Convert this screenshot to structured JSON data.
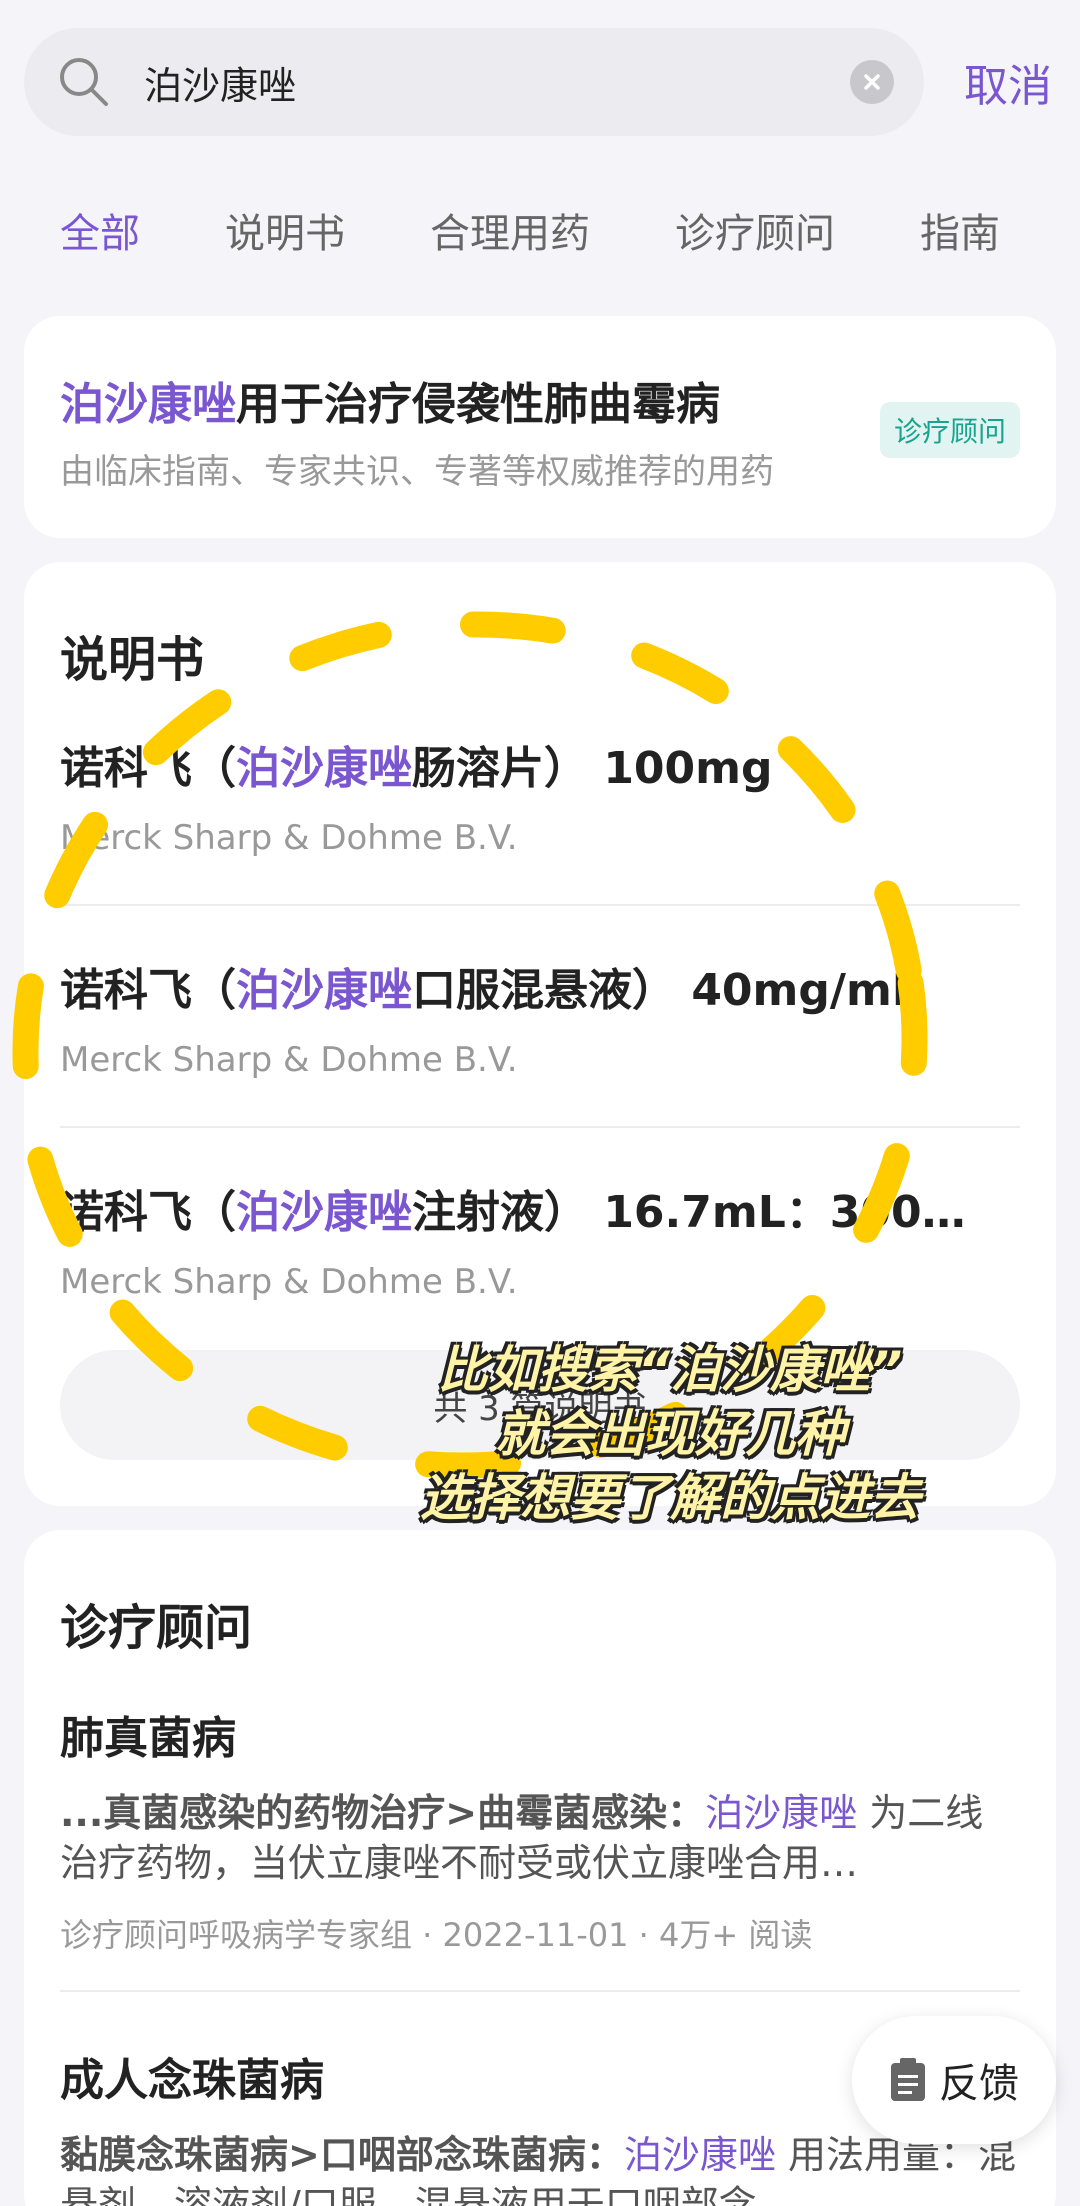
{
  "search": {
    "query": "泊沙康唑",
    "cancel_label": "取消"
  },
  "tabs": [
    {
      "label": "全部",
      "active": true
    },
    {
      "label": "说明书",
      "active": false
    },
    {
      "label": "合理用药",
      "active": false
    },
    {
      "label": "诊疗顾问",
      "active": false
    },
    {
      "label": "指南",
      "active": false
    }
  ],
  "highlight_term": "泊沙康唑",
  "top_card": {
    "title_highlight": "泊沙康唑",
    "title_rest": "用于治疗侵袭性肺曲霉病",
    "subtitle": "由临床指南、专家共识、专著等权威推荐的用药",
    "badge": "诊疗顾问"
  },
  "manual_section": {
    "title": "说明书",
    "items": [
      {
        "prefix": "诺科飞（",
        "highlight": "泊沙康唑",
        "suffix": "肠溶片） 100mg",
        "company": "Merck Sharp & Dohme B.V."
      },
      {
        "prefix": "诺科飞（",
        "highlight": "泊沙康唑",
        "suffix": "口服混悬液） 40mg/mL",
        "company": "Merck Sharp & Dohme B.V."
      },
      {
        "prefix": "诺科飞（",
        "highlight": "泊沙康唑",
        "suffix": "注射液） 16.7mL：300…",
        "company": "Merck Sharp & Dohme B.V."
      }
    ],
    "more_label": "共 3 篇说明书"
  },
  "consult_section": {
    "title": "诊疗顾问",
    "items": [
      {
        "title": "肺真菌病",
        "snippet_pre": "...真菌感染的药物治疗>曲霉菌感染：",
        "snippet_hl": "泊沙康唑",
        "snippet_post": " 为二线治疗药物，当伏立康唑不耐受或伏立康唑合用…",
        "meta": "诊疗顾问呼吸病学专家组 · 2022-11-01 · 4万+ 阅读"
      },
      {
        "title": "成人念珠菌病",
        "snippet_pre": "黏膜念珠菌病>口咽部念珠菌病：",
        "snippet_hl": "泊沙康唑",
        "snippet_post": " 用法用量：混悬剂、溶液剂/口服，混悬液用于口咽部念…",
        "meta": ""
      }
    ]
  },
  "feedback_label": "反馈",
  "caption_lines": [
    "比如搜索“泊沙康唑”",
    "就会出现好几种",
    "选择想要了解的点进去"
  ],
  "colors": {
    "accent": "#7a57d1",
    "badge_bg": "#e2f4f1",
    "badge_text": "#17a48f",
    "annotation_dash": "#ffcc00",
    "caption_text": "#fff3a8"
  }
}
